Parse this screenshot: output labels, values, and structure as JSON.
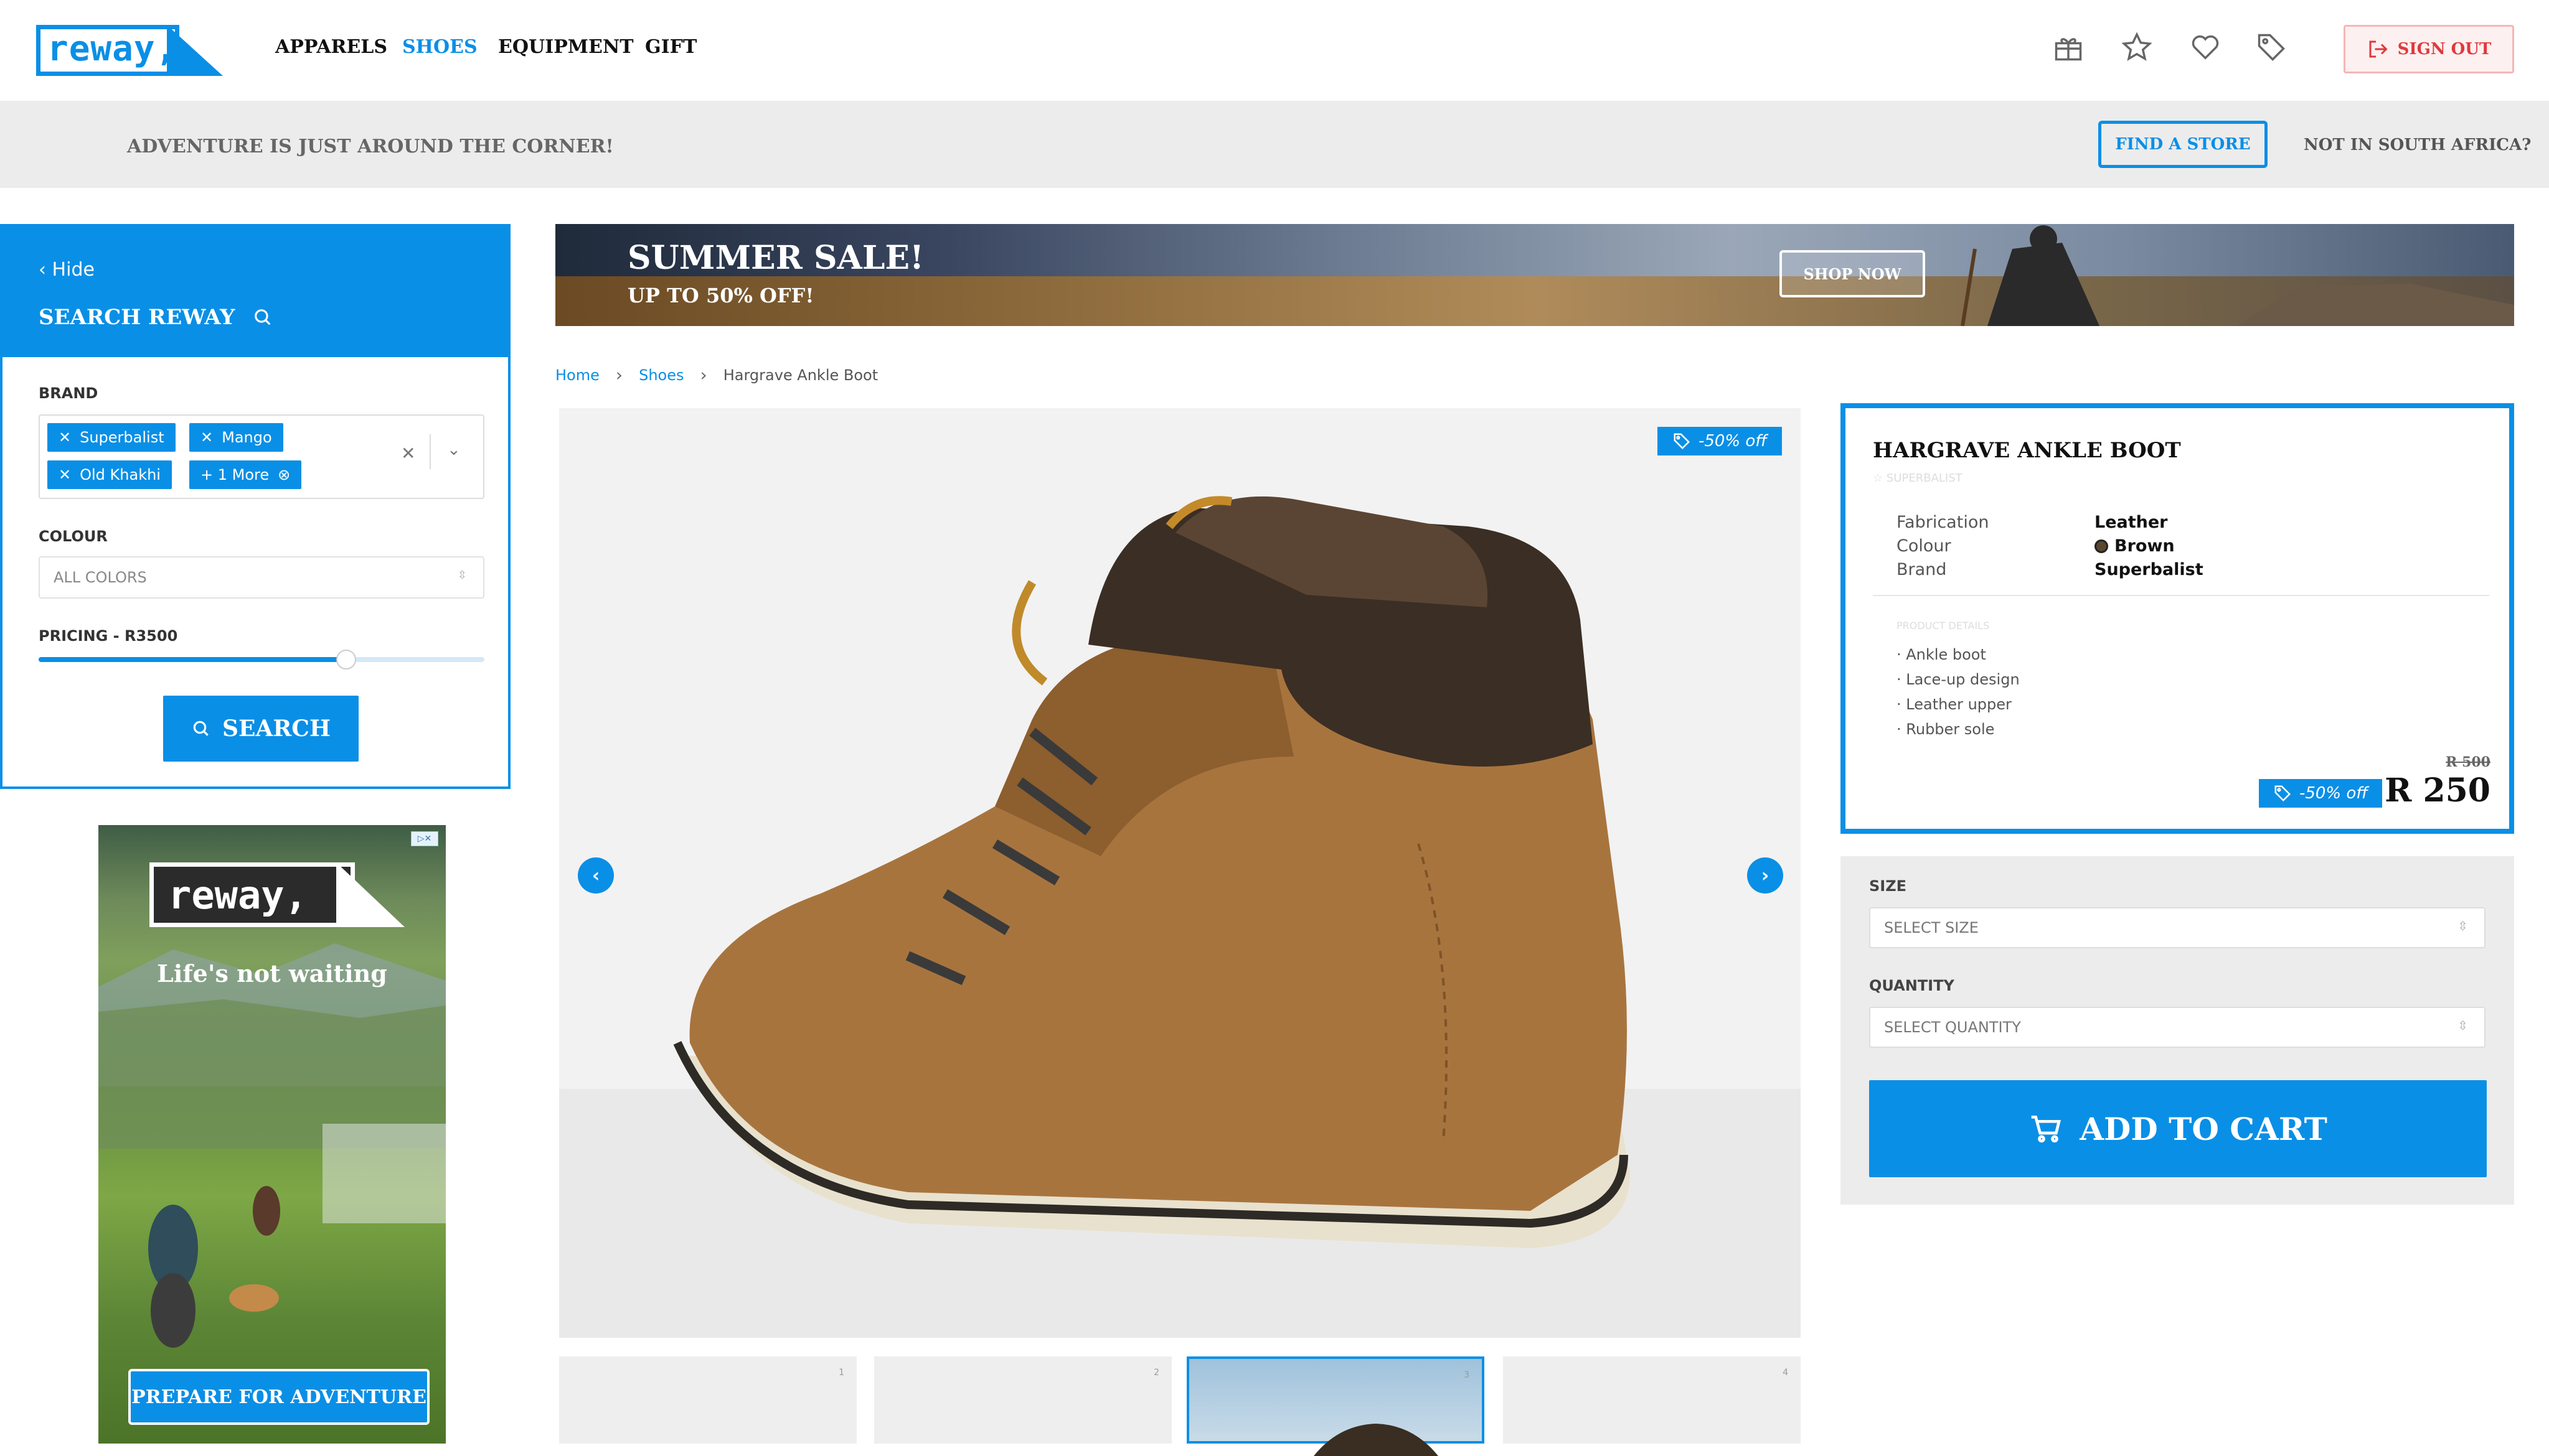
{
  "header": {
    "logo_text": "reway,",
    "nav": [
      "APPARELS",
      "SHOES",
      "EQUIPMENT",
      "GIFT"
    ],
    "active_nav": "SHOES",
    "icons": [
      "gift-icon",
      "star-icon",
      "heart-icon",
      "tag-icon"
    ],
    "signout_label": "SIGN OUT"
  },
  "subbar": {
    "tagline": "ADVENTURE IS JUST AROUND THE CORNER!",
    "find_store": "FIND A STORE",
    "not_in_sa": "NOT IN SOUTH AFRICA?"
  },
  "sidebar": {
    "hide_label": "Hide",
    "title": "SEARCH REWAY",
    "brand_label": "BRAND",
    "brand_chips": [
      "Superbalist",
      "Mango",
      "Old Khakhi",
      "+ 1 More"
    ],
    "colour_label": "COLOUR",
    "colour_value": "ALL COLORS",
    "pricing_label": "PRICING - R3500",
    "pricing_fraction": 0.69,
    "search_button": "SEARCH"
  },
  "ad": {
    "logo_text": "reway,",
    "tagline": "Life's not waiting",
    "button": "PREPARE FOR ADVENTURE"
  },
  "banner": {
    "title": "SUMMER SALE!",
    "subtitle": "UP TO 50% OFF!",
    "button": "SHOP NOW"
  },
  "breadcrumb": {
    "home": "Home",
    "category": "Shoes",
    "current": "Hargrave Ankle Boot"
  },
  "gallery": {
    "discount": "-50% off",
    "thumbs": [
      "1",
      "2",
      "3",
      "4"
    ],
    "active_thumb": 3
  },
  "product": {
    "name": "HARGRAVE ANKLE BOOT",
    "brand_faint": "SUPERBALIST",
    "specs": [
      {
        "key": "Fabrication",
        "value": "Leather"
      },
      {
        "key": "Colour",
        "value": "Brown"
      },
      {
        "key": "Brand",
        "value": "Superbalist"
      }
    ],
    "colour_swatch": "#5a4630",
    "details_label": "PRODUCT DETAILS",
    "details": [
      "Ankle boot",
      "Lace-up design",
      "Leather upper",
      "Rubber sole"
    ],
    "discount": "-50% off",
    "price_old": "R 500",
    "price_new": "R 250"
  },
  "cart": {
    "size_label": "SIZE",
    "size_placeholder": "SELECT SIZE",
    "qty_label": "QUANTITY",
    "qty_placeholder": "SELECT QUANTITY",
    "add_to_cart": "ADD TO CART"
  },
  "colors": {
    "accent": "#0a8fe6",
    "signout": "#e0393e"
  }
}
